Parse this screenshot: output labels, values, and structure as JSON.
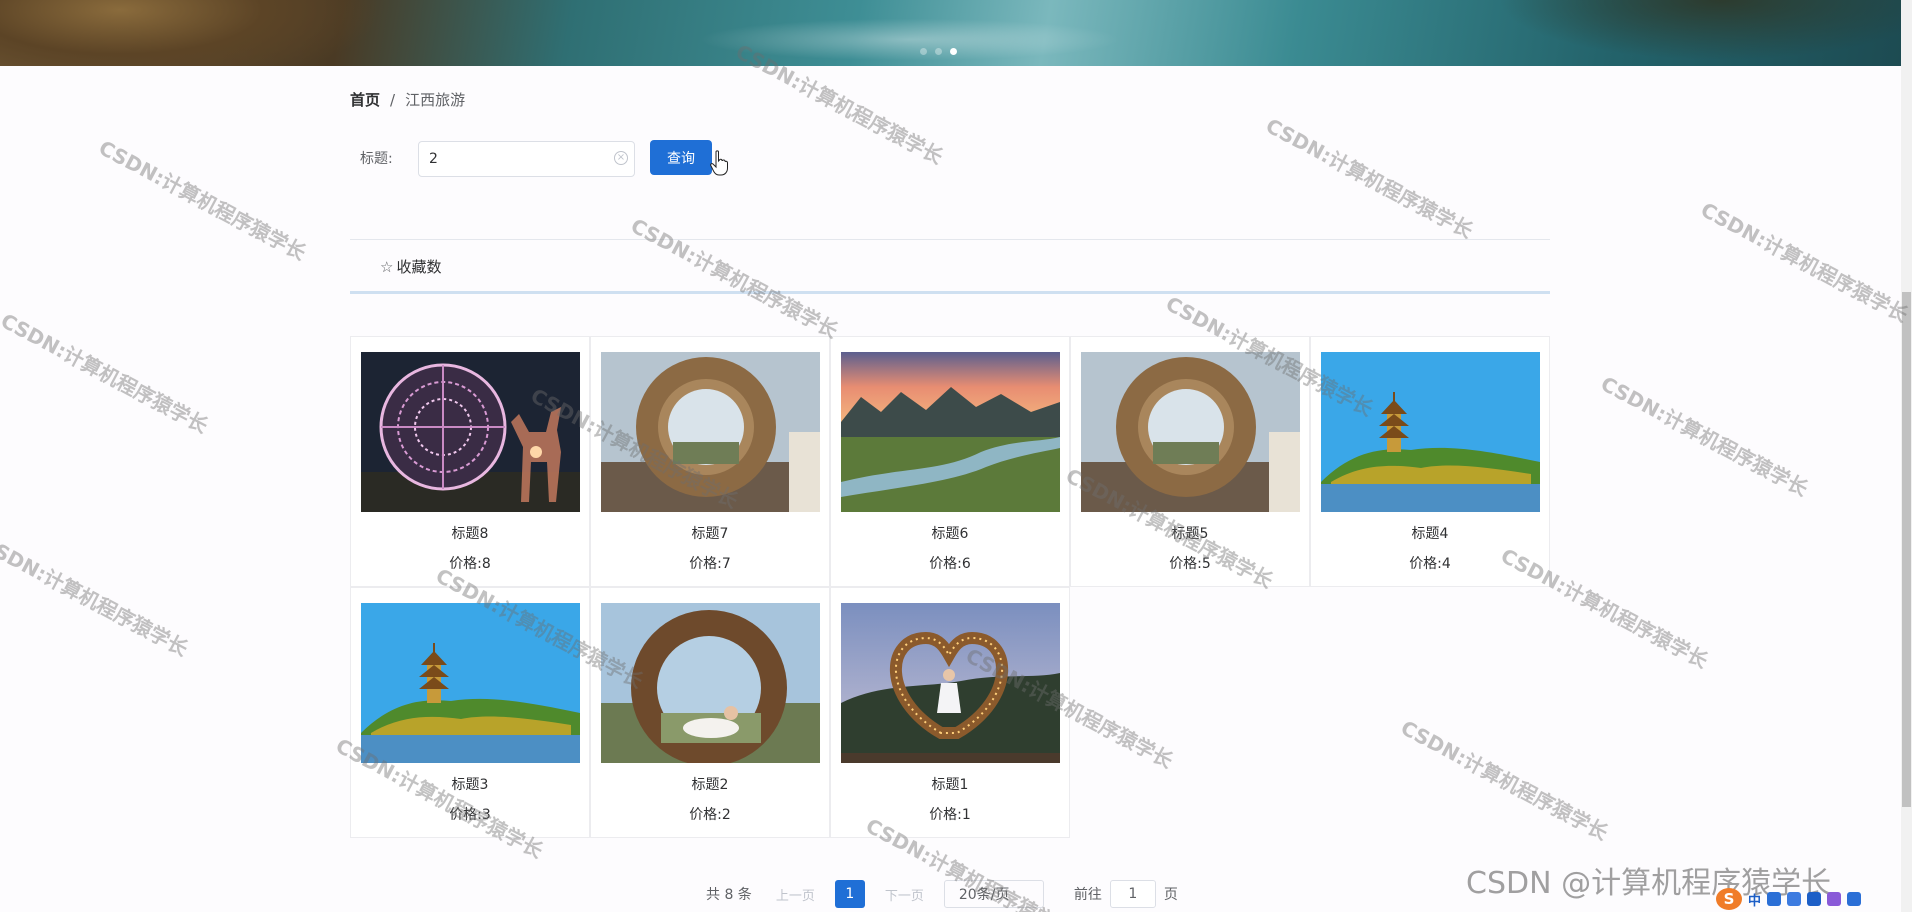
{
  "banner": {
    "slide_count": 3,
    "active_slide": 3
  },
  "breadcrumb": {
    "home": "首页",
    "separator": "/",
    "current": "江西旅游"
  },
  "search": {
    "label": "标题:",
    "value": "2",
    "button": "查询"
  },
  "sort": {
    "label": "收藏数"
  },
  "products": [
    {
      "title": "标题8",
      "price": "价格:8",
      "image": "lantern-ball-deer"
    },
    {
      "title": "标题7",
      "price": "价格:7",
      "image": "straw-nest-ring"
    },
    {
      "title": "标题6",
      "price": "价格:6",
      "image": "river-sunset"
    },
    {
      "title": "标题5",
      "price": "价格:5",
      "image": "straw-nest-ring"
    },
    {
      "title": "标题4",
      "price": "价格:4",
      "image": "pagoda-lake"
    },
    {
      "title": "标题3",
      "price": "价格:3",
      "image": "pagoda-lake"
    },
    {
      "title": "标题2",
      "price": "价格:2",
      "image": "branch-nest-girl"
    },
    {
      "title": "标题1",
      "price": "价格:1",
      "image": "heart-frame-girl"
    }
  ],
  "pagination": {
    "total": "共 8 条",
    "prev": "上一页",
    "current": "1",
    "next": "下一页",
    "page_size": "20条/页",
    "goto_label": "前往",
    "goto_value": "1",
    "goto_suffix": "页"
  },
  "watermark": {
    "text": "CSDN:计算机程序猿学长",
    "corner": "CSDN @计算机程序猿学长"
  },
  "tray": {
    "ime": "S",
    "lang": "中"
  },
  "colors": {
    "primary": "#1f6fd6",
    "sort_underline": "#cfe0f1",
    "border": "#dcdfe6"
  }
}
